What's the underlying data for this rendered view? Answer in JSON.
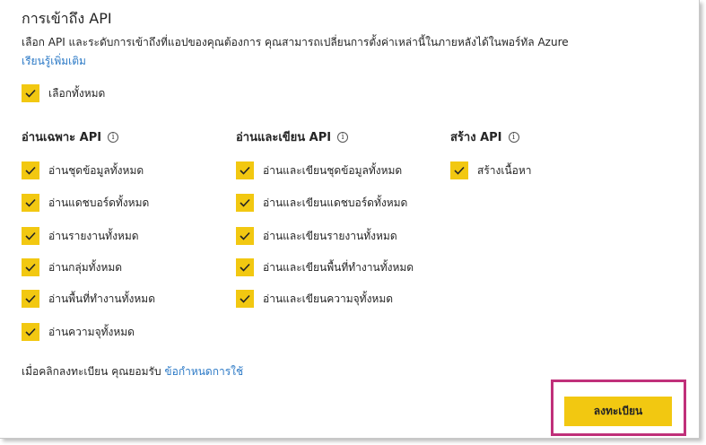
{
  "title": "การเข้าถึง API",
  "description": "เลือก API และระดับการเข้าถึงที่แอปของคุณต้องการ คุณสามารถเปลี่ยนการตั้งค่าเหล่านี้ในภายหลังได้ในพอร์ทัล Azure",
  "learn_more": "เรียนรู้เพิ่มเติม",
  "select_all": {
    "label": "เลือกทั้งหมด",
    "checked": true
  },
  "sections": [
    {
      "heading": "อ่านเฉพาะ API",
      "items": [
        {
          "label": "อ่านชุดข้อมูลทั้งหมด",
          "checked": true
        },
        {
          "label": "อ่านแดชบอร์ดทั้งหมด",
          "checked": true
        },
        {
          "label": "อ่านรายงานทั้งหมด",
          "checked": true
        },
        {
          "label": "อ่านกลุ่มทั้งหมด",
          "checked": true
        },
        {
          "label": "อ่านพื้นที่ทำงานทั้งหมด",
          "checked": true
        },
        {
          "label": "อ่านความจุทั้งหมด",
          "checked": true
        }
      ]
    },
    {
      "heading": "อ่านและเขียน API",
      "items": [
        {
          "label": "อ่านและเขียนชุดข้อมูลทั้งหมด",
          "checked": true
        },
        {
          "label": "อ่านและเขียนแดชบอร์ดทั้งหมด",
          "checked": true
        },
        {
          "label": "อ่านและเขียนรายงานทั้งหมด",
          "checked": true
        },
        {
          "label": "อ่านและเขียนพื้นที่ทำงานทั้งหมด",
          "checked": true
        },
        {
          "label": "อ่านและเขียนความจุทั้งหมด",
          "checked": true
        }
      ]
    },
    {
      "heading": "สร้าง API",
      "items": [
        {
          "label": "สร้างเนื้อหา",
          "checked": true
        }
      ]
    }
  ],
  "info_glyph": "i",
  "consent_text": "เมื่อคลิกลงทะเบียน คุณยอมรับ",
  "terms_link": "ข้อกำหนดการใช้",
  "register_button": "ลงทะเบียน",
  "colors": {
    "checkbox": "#f2c811",
    "button": "#f2c811",
    "link": "#2b79c6",
    "highlight": "#c0307a"
  }
}
